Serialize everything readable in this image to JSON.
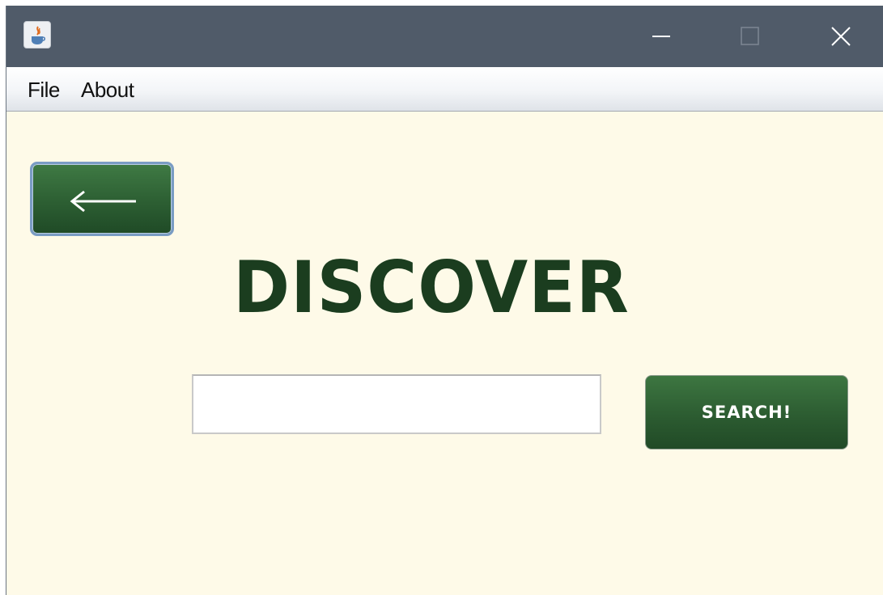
{
  "window": {
    "title": "",
    "controls": {
      "minimize_icon": "minimize-icon",
      "maximize_icon": "maximize-icon",
      "close_icon": "close-icon"
    }
  },
  "menubar": {
    "items": [
      {
        "label": "File"
      },
      {
        "label": "About"
      }
    ]
  },
  "main": {
    "back_button_icon": "left-arrow-icon",
    "heading": "DISCOVER",
    "search": {
      "value": "",
      "placeholder": ""
    },
    "search_button_label": "SEARCH!"
  },
  "colors": {
    "titlebar": "#505b69",
    "background": "#fefae8",
    "button_green": "#2e6134",
    "heading_green": "#1b3d1f"
  }
}
